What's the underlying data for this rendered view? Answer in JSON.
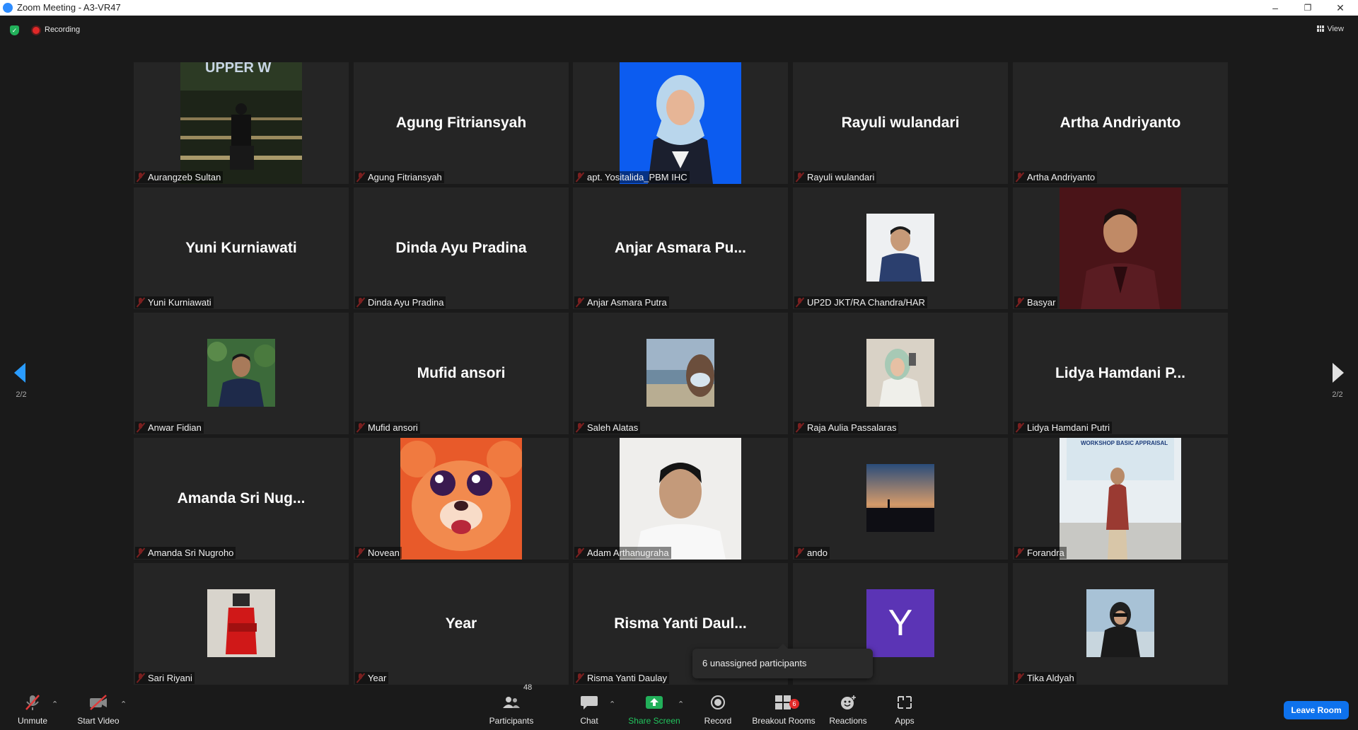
{
  "window": {
    "title": "Zoom Meeting - A3-VR47"
  },
  "topbar": {
    "recording_label": "Recording",
    "view_label": "View"
  },
  "pager": {
    "left_label": "2/2",
    "right_label": "2/2"
  },
  "tiles": [
    {
      "label": "Aurangzeb Sultan",
      "display": ""
    },
    {
      "label": "Agung Fitriansyah",
      "display": "Agung Fitriansyah"
    },
    {
      "label": "apt. Yositalida_PBM IHC",
      "display": ""
    },
    {
      "label": "Rayuli wulandari",
      "display": "Rayuli wulandari"
    },
    {
      "label": "Artha Andriyanto",
      "display": "Artha Andriyanto"
    },
    {
      "label": "Yuni Kurniawati",
      "display": "Yuni Kurniawati"
    },
    {
      "label": "Dinda Ayu Pradina",
      "display": "Dinda Ayu Pradina"
    },
    {
      "label": "Anjar Asmara Putra",
      "display": "Anjar Asmara Pu..."
    },
    {
      "label": "UP2D JKT/RA Chandra/HAR",
      "display": ""
    },
    {
      "label": "Basyar",
      "display": ""
    },
    {
      "label": "Anwar Fidian",
      "display": ""
    },
    {
      "label": "Mufid ansori",
      "display": "Mufid ansori"
    },
    {
      "label": "Saleh Alatas",
      "display": ""
    },
    {
      "label": "Raja Aulia Passalaras",
      "display": ""
    },
    {
      "label": "Lidya Hamdani Putri",
      "display": "Lidya Hamdani P..."
    },
    {
      "label": "Amanda Sri Nugroho",
      "display": "Amanda Sri Nug..."
    },
    {
      "label": "Novean",
      "display": ""
    },
    {
      "label": "Adam Arthanugraha",
      "display": ""
    },
    {
      "label": "ando",
      "display": ""
    },
    {
      "label": "Forandra",
      "display": ""
    },
    {
      "label": "Sari Riyani",
      "display": ""
    },
    {
      "label": "Year",
      "display": "Year"
    },
    {
      "label": "Risma Yanti Daulay",
      "display": "Risma Yanti Daul..."
    },
    {
      "label": "",
      "display": "",
      "avatar_letter": "Y"
    },
    {
      "label": "Tika Aldyah",
      "display": ""
    }
  ],
  "tooltip": {
    "text": "6 unassigned participants"
  },
  "toolbar": {
    "unmute": "Unmute",
    "start_video": "Start Video",
    "participants": "Participants",
    "participants_count": "48",
    "chat": "Chat",
    "share_screen": "Share Screen",
    "record": "Record",
    "breakout_rooms": "Breakout Rooms",
    "breakout_badge": "6",
    "reactions": "Reactions",
    "apps": "Apps",
    "leave_room": "Leave Room"
  },
  "colors": {
    "accent": "#0e72ed",
    "share_green": "#22b05a",
    "mute_red": "#e03b3b"
  }
}
